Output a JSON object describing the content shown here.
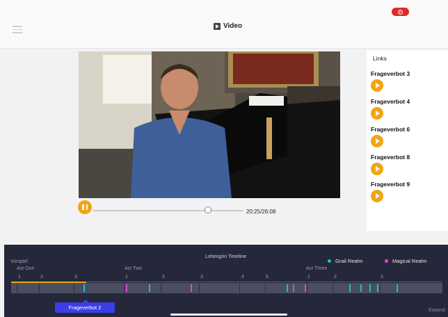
{
  "header": {
    "title": "Video"
  },
  "player": {
    "time": "20:25/26:08",
    "progress": 0.78
  },
  "links": {
    "heading": "Links",
    "items": [
      {
        "label": "Frageverbot 3"
      },
      {
        "label": "Frageverbot 4"
      },
      {
        "label": "Frageverbot 6"
      },
      {
        "label": "Frageverbot 8"
      },
      {
        "label": "Frageverbot 9"
      }
    ]
  },
  "timeline": {
    "title": "Lohengrin Timeline",
    "vorspiel": "Vorspiel",
    "acts": [
      "Act One",
      "Act Two",
      "Act Three"
    ],
    "numbers": [
      "1",
      "2",
      "3",
      "1",
      "2",
      "3",
      "4",
      "5",
      "1",
      "2",
      "3"
    ],
    "legend": [
      {
        "label": "Grail Realm",
        "color": "#19c3c8"
      },
      {
        "label": "Magical Realm",
        "color": "#e83de0"
      }
    ],
    "current_tag": "Frageverbot 2",
    "expand": "Expand"
  },
  "colors": {
    "accent": "#f2a413",
    "record": "#e02828",
    "timeline_bg": "#25283a"
  }
}
